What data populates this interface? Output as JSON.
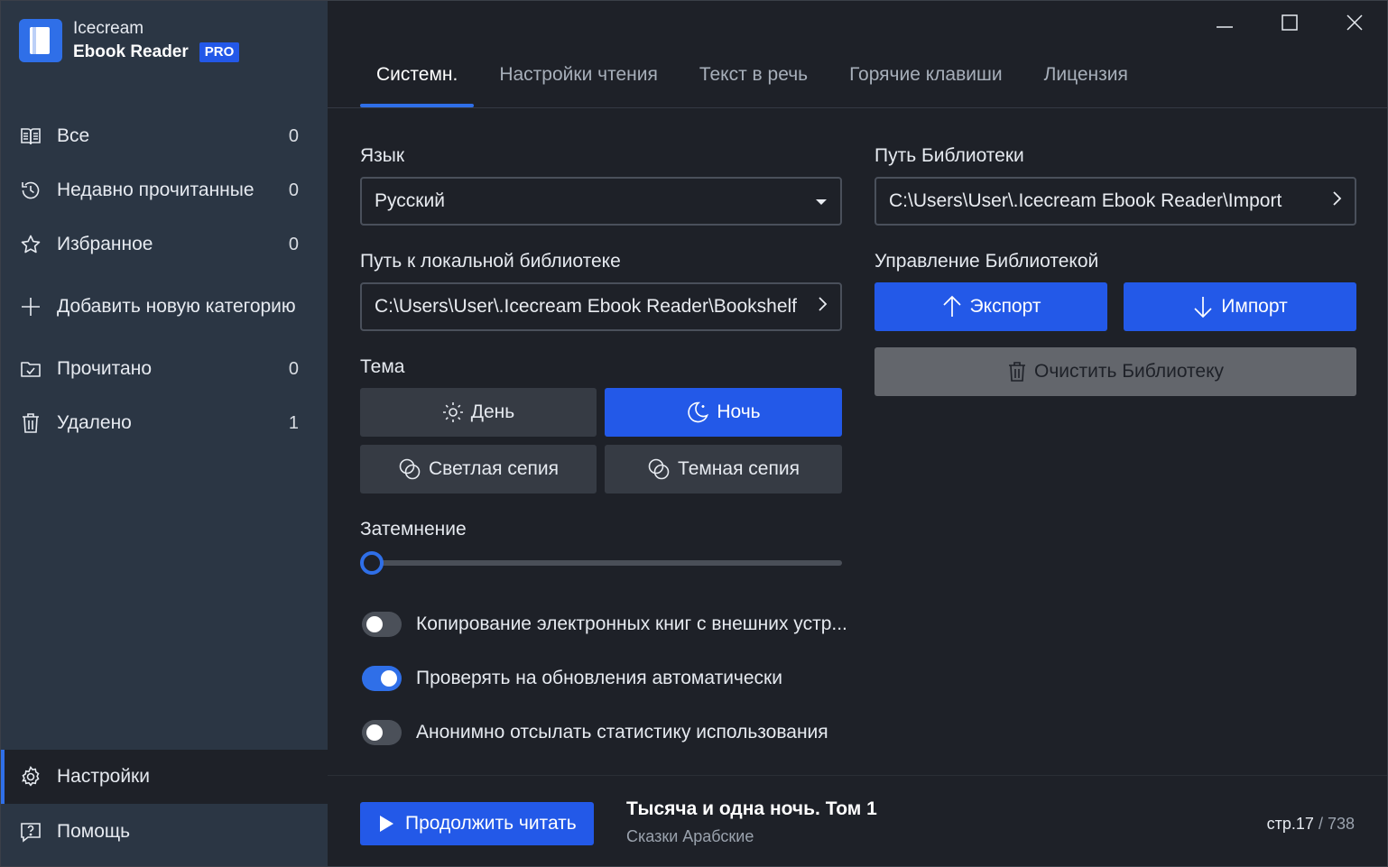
{
  "app": {
    "name_line1": "Icecream",
    "name_line2": "Ebook Reader",
    "badge": "PRO"
  },
  "sidebar": {
    "items": [
      {
        "label": "Все",
        "count": "0",
        "icon": "book-open-icon"
      },
      {
        "label": "Недавно прочитанные",
        "count": "0",
        "icon": "history-icon"
      },
      {
        "label": "Избранное",
        "count": "0",
        "icon": "star-icon"
      },
      {
        "label": "Добавить новую категорию",
        "count": "",
        "icon": "plus-icon"
      },
      {
        "label": "Прочитано",
        "count": "0",
        "icon": "folder-check-icon"
      },
      {
        "label": "Удалено",
        "count": "1",
        "icon": "trash-icon"
      }
    ],
    "settings_label": "Настройки",
    "help_label": "Помощь"
  },
  "tabs": [
    {
      "label": "Системн.",
      "active": true
    },
    {
      "label": "Настройки чтения",
      "active": false
    },
    {
      "label": "Текст в речь",
      "active": false
    },
    {
      "label": "Горячие клавиши",
      "active": false
    },
    {
      "label": "Лицензия",
      "active": false
    }
  ],
  "settings": {
    "language_label": "Язык",
    "language_value": "Русский",
    "local_library_label": "Путь к локальной библиотеке",
    "local_library_path": "C:\\Users\\User\\.Icecream Ebook Reader\\Bookshelf",
    "theme_label": "Тема",
    "themes": {
      "day": "День",
      "night": "Ночь",
      "light_sepia": "Светлая сепия",
      "dark_sepia": "Темная сепия",
      "selected": "night"
    },
    "dimming_label": "Затемнение",
    "dimming_value": 0,
    "toggles": [
      {
        "label": "Копирование электронных книг с внешних устр...",
        "on": false
      },
      {
        "label": "Проверять на обновления автоматически",
        "on": true
      },
      {
        "label": "Анонимно отсылать статистику использования",
        "on": false
      }
    ],
    "library_path_label": "Путь Библиотеки",
    "library_path": "C:\\Users\\User\\.Icecream Ebook Reader\\Import",
    "library_management_label": "Управление Библиотекой",
    "export_label": "Экспорт",
    "import_label": "Импорт",
    "clear_label": "Очистить Библиотеку"
  },
  "footer": {
    "continue_label": "Продолжить читать",
    "book_title": "Тысяча и одна ночь. Том 1",
    "book_author": "Сказки Арабские",
    "page_current": "стр.17",
    "page_total": "738"
  },
  "colors": {
    "accent": "#2359e8",
    "sidebar_bg": "#2b3644",
    "main_bg": "#1e2128"
  }
}
